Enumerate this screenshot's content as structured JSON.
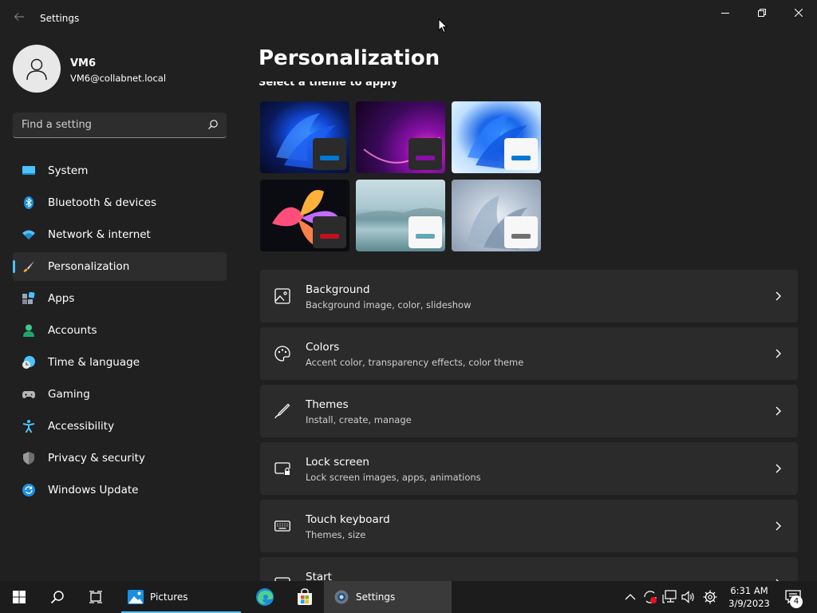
{
  "window": {
    "title": "Settings"
  },
  "profile": {
    "name": "VM6",
    "email": "VM6@collabnet.local"
  },
  "search": {
    "placeholder": "Find a setting"
  },
  "sidebar": {
    "items": [
      {
        "label": "System",
        "icon": "monitor-icon"
      },
      {
        "label": "Bluetooth & devices",
        "icon": "bluetooth-icon"
      },
      {
        "label": "Network & internet",
        "icon": "wifi-icon"
      },
      {
        "label": "Personalization",
        "icon": "brush-icon",
        "selected": true
      },
      {
        "label": "Apps",
        "icon": "apps-icon"
      },
      {
        "label": "Accounts",
        "icon": "person-icon"
      },
      {
        "label": "Time & language",
        "icon": "clock-globe-icon"
      },
      {
        "label": "Gaming",
        "icon": "gamepad-icon"
      },
      {
        "label": "Accessibility",
        "icon": "accessibility-icon"
      },
      {
        "label": "Privacy & security",
        "icon": "shield-icon"
      },
      {
        "label": "Windows Update",
        "icon": "update-icon"
      }
    ]
  },
  "main": {
    "title": "Personalization",
    "theme_heading": "Select a theme to apply",
    "themes": [
      {
        "name": "windows-dark",
        "accent": "#0078d4"
      },
      {
        "name": "glow",
        "accent": "#8a0fa8"
      },
      {
        "name": "windows-light",
        "accent": "#0078d4"
      },
      {
        "name": "captured-motion",
        "accent": "#c50f1f"
      },
      {
        "name": "sunrise",
        "accent": "#5fa8b8"
      },
      {
        "name": "flow",
        "accent": "#707070"
      }
    ],
    "cards": [
      {
        "title": "Background",
        "desc": "Background image, color, slideshow",
        "icon": "image-icon"
      },
      {
        "title": "Colors",
        "desc": "Accent color, transparency effects, color theme",
        "icon": "palette-icon"
      },
      {
        "title": "Themes",
        "desc": "Install, create, manage",
        "icon": "pen-icon"
      },
      {
        "title": "Lock screen",
        "desc": "Lock screen images, apps, animations",
        "icon": "lock-screen-icon"
      },
      {
        "title": "Touch keyboard",
        "desc": "Themes, size",
        "icon": "keyboard-icon"
      },
      {
        "title": "Start",
        "desc": "",
        "icon": "start-icon"
      }
    ]
  },
  "taskbar": {
    "apps": [
      {
        "label": "Pictures",
        "icon": "photos-icon"
      },
      {
        "label": "Settings",
        "icon": "settings-icon"
      }
    ],
    "time": "6:31 AM",
    "date": "3/9/2023",
    "notifications": "4"
  },
  "colors": {
    "accent": "#4cc2ff",
    "background": "#202020",
    "card": "#2b2b2b"
  }
}
